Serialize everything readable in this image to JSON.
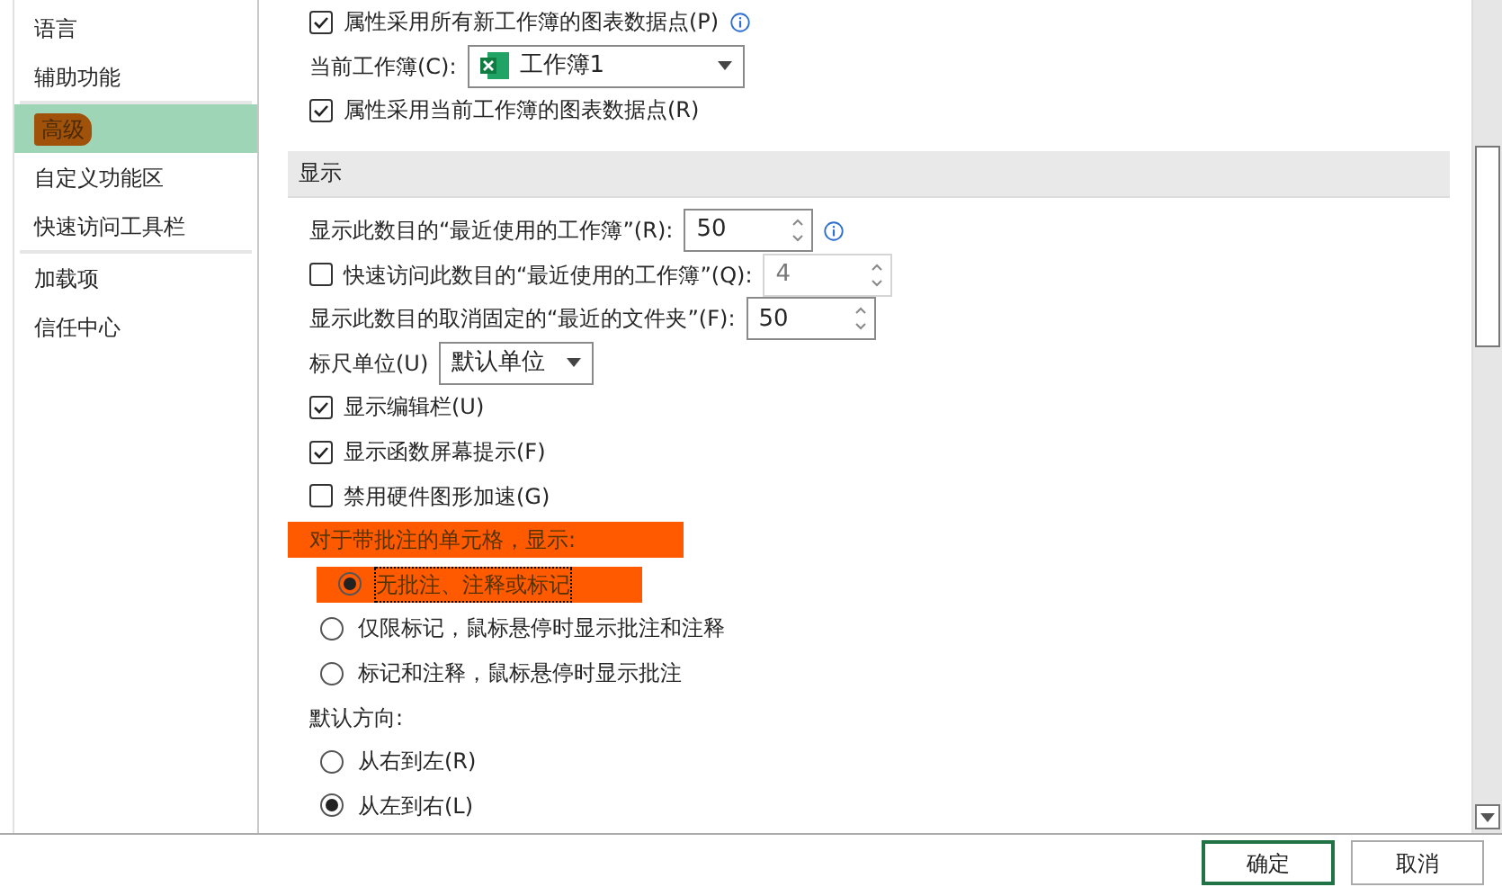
{
  "sidebar": {
    "items": [
      {
        "label": "语言",
        "selected": false,
        "marked": false
      },
      {
        "label": "辅助功能",
        "selected": false,
        "marked": false
      },
      {
        "label": "高级",
        "selected": true,
        "marked": true
      },
      {
        "label": "自定义功能区",
        "selected": false,
        "marked": false
      },
      {
        "label": "快速访问工具栏",
        "selected": false,
        "marked": false
      },
      {
        "label": "加载项",
        "selected": false,
        "marked": false
      },
      {
        "label": "信任中心",
        "selected": false,
        "marked": false
      }
    ]
  },
  "options": [
    {
      "kind": "checkbox",
      "label": "属性采用所有新工作簿的图表数据点(P)",
      "checked": true,
      "info": true
    },
    {
      "kind": "workbook-select",
      "label": "当前工作簿(C):",
      "value": "工作簿1"
    },
    {
      "kind": "checkbox",
      "label": "属性采用当前工作簿的图表数据点(R)",
      "checked": true,
      "info": false
    },
    {
      "kind": "section",
      "label": "显示"
    },
    {
      "kind": "spin",
      "label": "显示此数目的“最近使用的工作簿”(R):",
      "value": "50",
      "info": true,
      "disabled": false
    },
    {
      "kind": "check-spin",
      "label": "快速访问此数目的“最近使用的工作簿”(Q):",
      "checked": false,
      "value": "4",
      "disabled": true
    },
    {
      "kind": "spin",
      "label": "显示此数目的取消固定的“最近的文件夹”(F):",
      "value": "50",
      "info": false,
      "disabled": false
    },
    {
      "kind": "select",
      "label": "标尺单位(U)",
      "value": "默认单位"
    },
    {
      "kind": "checkbox",
      "label": "显示编辑栏(U)",
      "checked": true,
      "info": false
    },
    {
      "kind": "checkbox",
      "label": "显示函数屏幕提示(F)",
      "checked": true,
      "info": false
    },
    {
      "kind": "checkbox",
      "label": "禁用硬件图形加速(G)",
      "checked": false,
      "info": false
    },
    {
      "kind": "label",
      "label": "对于带批注的单元格，显示:",
      "marked": true
    },
    {
      "kind": "radio",
      "label": "无批注、注释或标记",
      "selected": true,
      "focused": true,
      "marked": true
    },
    {
      "kind": "radio",
      "label": "仅限标记，鼠标悬停时显示批注和注释",
      "selected": false
    },
    {
      "kind": "radio",
      "label": "标记和注释，鼠标悬停时显示批注",
      "selected": false
    },
    {
      "kind": "label",
      "label": "默认方向:"
    },
    {
      "kind": "radio",
      "label": "从右到左(R)",
      "selected": false
    },
    {
      "kind": "radio",
      "label": "从左到右(L)",
      "selected": true
    }
  ],
  "buttons": [
    {
      "label": "确定",
      "default": true
    },
    {
      "label": "取消",
      "default": false
    }
  ]
}
